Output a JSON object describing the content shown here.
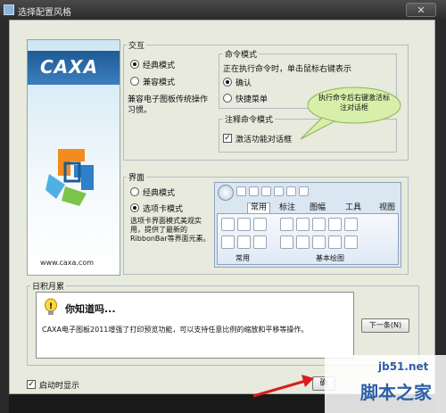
{
  "window": {
    "title": "选择配置风格",
    "close_label": "✕"
  },
  "logo": {
    "brand": "CAXA",
    "url": "www.caxa.com"
  },
  "interaction": {
    "group_label": "交互",
    "classic_label": "经典模式",
    "compat_label": "兼容模式",
    "compat_desc": "兼容电子图板传统操作习惯。",
    "command_mode": {
      "label": "命令模式",
      "desc": "正在执行命令时，单击鼠标右键表示",
      "confirm_label": "确认",
      "shortcut_label": "快捷菜单"
    },
    "annotation_mode": {
      "label": "注释命令模式",
      "activate_label": "激活功能对话框"
    },
    "bubble_text": "执行命令后右键激活标注对话框"
  },
  "ui": {
    "group_label": "界面",
    "classic_label": "经典模式",
    "ribbon_label": "选项卡模式",
    "ribbon_desc": "选项卡界面模式美观实用，提供了最新的RibbonBar等界面元素。",
    "preview": {
      "tabs": [
        "常用",
        "标注",
        "图幅",
        "工具",
        "视图"
      ],
      "groups": [
        "常用",
        "基本绘图"
      ]
    }
  },
  "tips": {
    "group_label": "日积月累",
    "heading": "你知道吗...",
    "body": "CAXA电子图板2011增强了打印预览功能，可以支持任意比例的缩放和平移等操作。",
    "next_button": "下一条(N)"
  },
  "footer": {
    "startup_label": "启动时显示",
    "partial_text": "确"
  },
  "watermark": {
    "site": "jb51.net",
    "brand": "脚本之家"
  },
  "colors": {
    "accent_blue": "#1f5a94",
    "bubble": "#d7efa8"
  }
}
